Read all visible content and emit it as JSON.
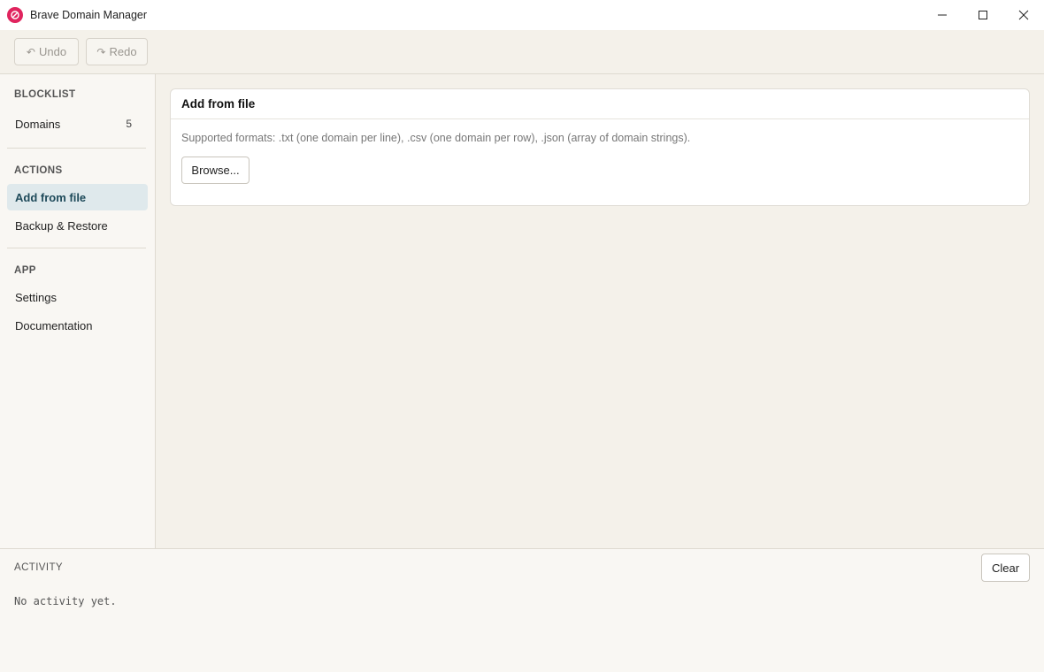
{
  "window": {
    "title": "Brave Domain Manager",
    "logo_icon": "brave-logo-icon",
    "accent": "#e0245e"
  },
  "toolbar": {
    "undo_label": "Undo",
    "undo_glyph": "↶",
    "redo_label": "Redo",
    "redo_glyph": "↷"
  },
  "sidebar": {
    "sections": [
      {
        "heading": "BLOCKLIST",
        "items": [
          {
            "label": "Domains",
            "count": "5"
          }
        ]
      },
      {
        "heading": "ACTIONS",
        "items": [
          {
            "label": "Add from file",
            "active": true
          },
          {
            "label": "Backup & Restore"
          }
        ]
      },
      {
        "heading": "APP",
        "items": [
          {
            "label": "Settings"
          },
          {
            "label": "Documentation"
          }
        ]
      }
    ],
    "active_color": "#dfe9ec"
  },
  "main": {
    "card": {
      "title": "Add from file",
      "description": "Supported formats: .txt (one domain per line), .csv (one domain per row), .json (array of domain strings).",
      "browse_label": "Browse..."
    }
  },
  "activity": {
    "heading": "ACTIVITY",
    "clear_label": "Clear",
    "empty_text": "No activity yet."
  }
}
